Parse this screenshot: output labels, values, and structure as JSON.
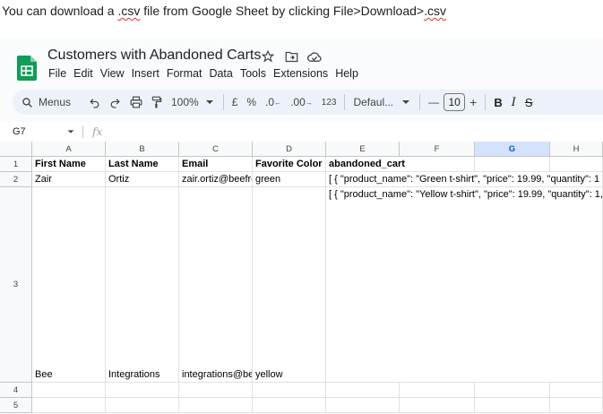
{
  "caption": {
    "before": "You can download a ",
    "csv1": ".csv",
    "middle": " file from Google Sheet by clicking File>Download>",
    "csv2": ".csv"
  },
  "sheet": {
    "title": "Customers with Abandoned Carts",
    "menu": [
      "File",
      "Edit",
      "View",
      "Insert",
      "Format",
      "Data",
      "Tools",
      "Extensions",
      "Help"
    ],
    "toolbar": {
      "menus_label": "Menus",
      "zoom": "100%",
      "currency": "£",
      "percent": "%",
      "dec_decrease": ".0",
      "dec_increase": ".00",
      "number_format": "123",
      "font": "Defaul...",
      "font_size": "10",
      "minus": "—",
      "plus": "+",
      "bold": "B",
      "italic": "I",
      "strike": "S"
    },
    "name_box": "G7",
    "fx": "fx",
    "columns": [
      "A",
      "B",
      "C",
      "D",
      "E",
      "F",
      "G",
      "H"
    ],
    "selected_column": "G",
    "rows": [
      "1",
      "2",
      "3",
      "4",
      "5"
    ],
    "headers": [
      "First Name",
      "Last Name",
      "Email",
      "Favorite Color",
      "abandoned_cart"
    ],
    "row2": [
      "Zair",
      "Ortiz",
      "zair.ortiz@beefre",
      "green",
      "[ { \"product_name\": \"Green t-shirt\", \"price\": 19.99, \"quantity\": 1"
    ],
    "row3": {
      "first": "Bee",
      "last": "Integrations",
      "email": "integrations@be",
      "color": "yellow",
      "json": "[\n  {\n     \"product_name\": \"Yellow t-shirt\",\n     \"price\": 19.99,\n     \"quantity\": 1,\n     \"image\": \"https://encrypted-tbn0.gstatic.com/images?q=tb\n     \"product_url\": \"https://www.target.com/s/yellow+shirt\"\n  },\n  {\n     \"product_name\": \"Yellow shorts\",\n     \"price\": 29.99,\n     \"quantity\": 2,\n     \"image\": \"https://encrypted-tbn0.gstatic.com/images?q=tb\n     \"product_url\": \"https://www.target.com/s/mens+yellow+sh\n  }\n]"
    }
  },
  "colors": {
    "accent": "#0b57d0",
    "logo_green": "#0f9d58",
    "toolbar_bg": "#edf2fa"
  }
}
